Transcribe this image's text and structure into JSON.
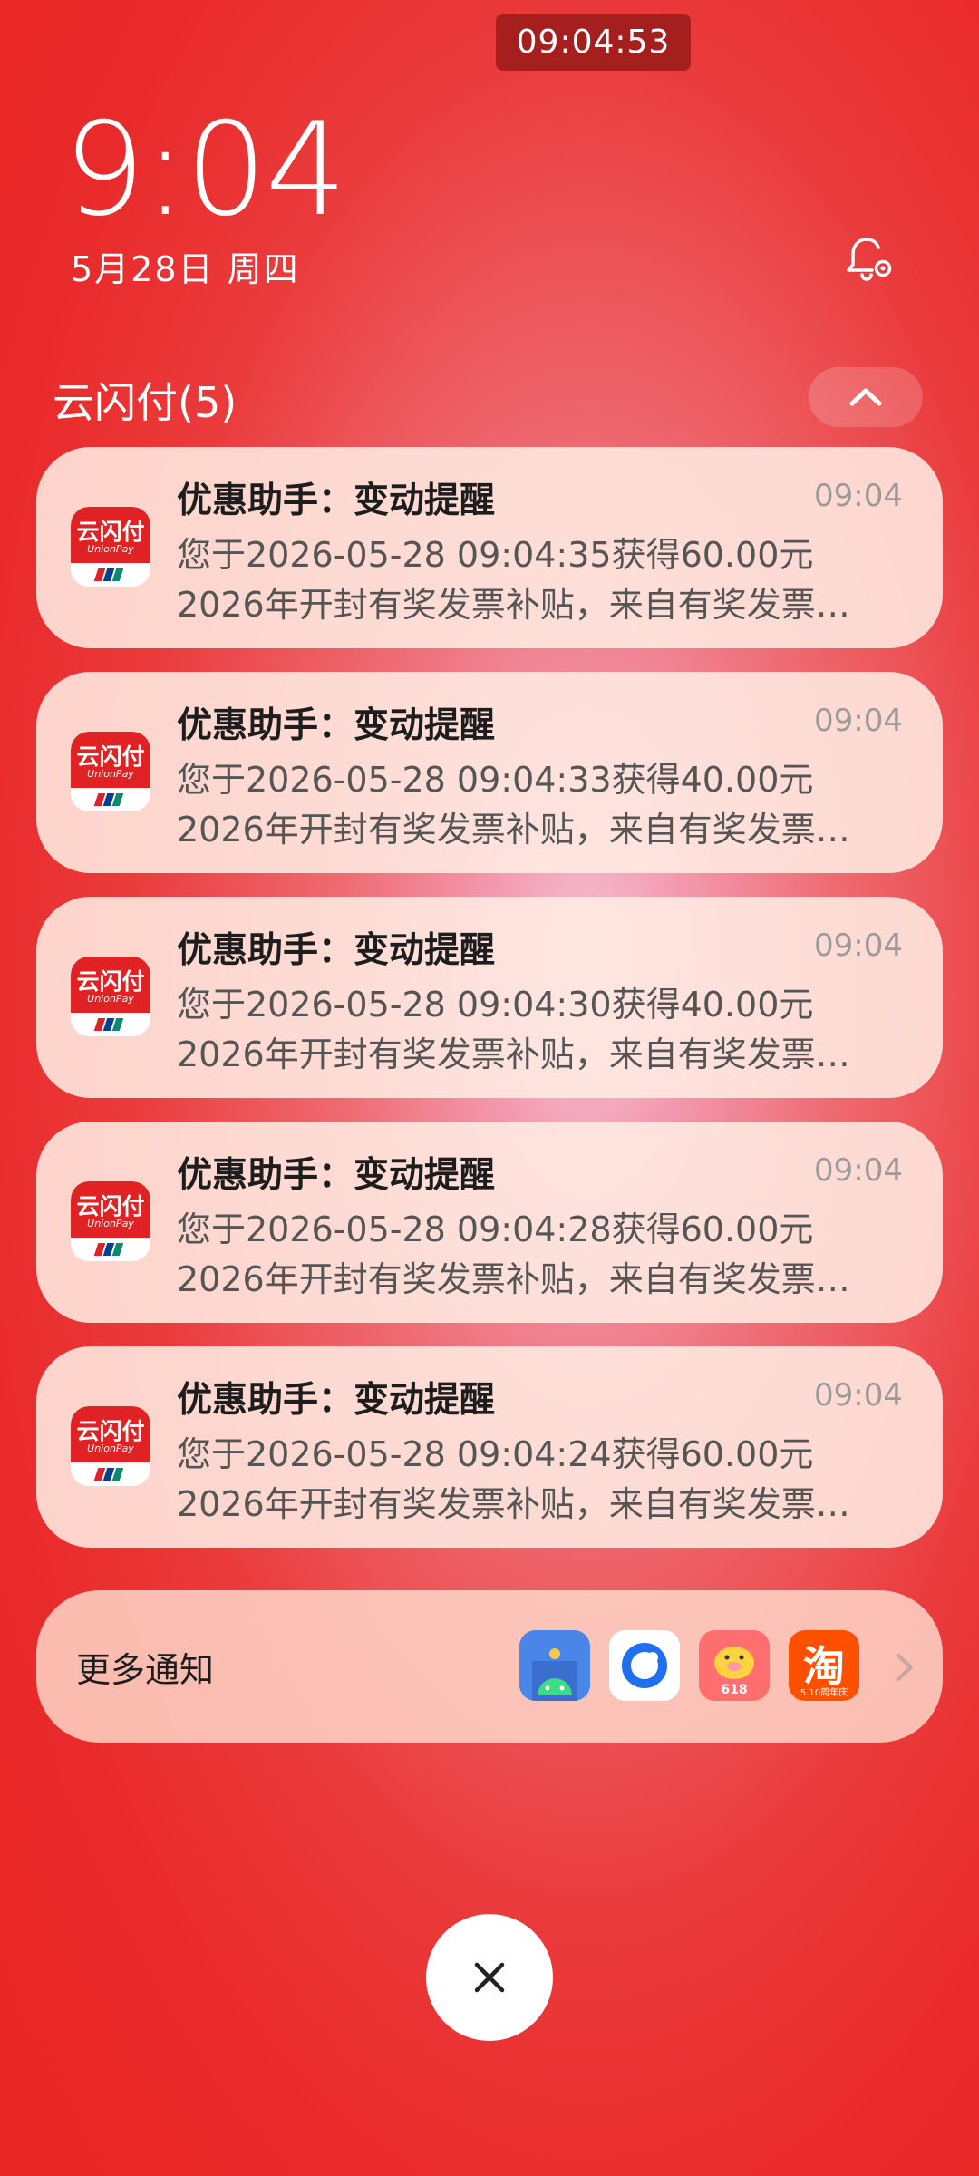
{
  "status": {
    "clock": "09:04:53"
  },
  "lockscreen": {
    "time": "9:04",
    "date": "5月28日 周四"
  },
  "group": {
    "title": "云闪付(5)"
  },
  "app_icon": {
    "brand_text": "云闪付",
    "brand_sub": "UnionPay"
  },
  "notifications": [
    {
      "title": "优惠助手：变动提醒",
      "time": "09:04",
      "line1": "您于2026-05-28 09:04:35获得60.00元",
      "line2": "2026年开封有奖发票补贴，来自有奖发票…"
    },
    {
      "title": "优惠助手：变动提醒",
      "time": "09:04",
      "line1": "您于2026-05-28 09:04:33获得40.00元",
      "line2": "2026年开封有奖发票补贴，来自有奖发票…"
    },
    {
      "title": "优惠助手：变动提醒",
      "time": "09:04",
      "line1": "您于2026-05-28 09:04:30获得40.00元",
      "line2": "2026年开封有奖发票补贴，来自有奖发票…"
    },
    {
      "title": "优惠助手：变动提醒",
      "time": "09:04",
      "line1": "您于2026-05-28 09:04:28获得60.00元",
      "line2": "2026年开封有奖发票补贴，来自有奖发票…"
    },
    {
      "title": "优惠助手：变动提醒",
      "time": "09:04",
      "line1": "您于2026-05-28 09:04:24获得60.00元",
      "line2": "2026年开封有奖发票补贴，来自有奖发票…"
    }
  ],
  "more": {
    "label": "更多通知",
    "apps": [
      {
        "icon": "android-app-icon"
      },
      {
        "icon": "blue-ring-app-icon"
      },
      {
        "icon": "pig-618-app-icon",
        "text": "618"
      },
      {
        "icon": "taobao-app-icon",
        "text": "淘",
        "sub": "5.10周年庆"
      }
    ]
  },
  "colors": {
    "background": "#ea2c2c",
    "unionpay_red": "#e02225",
    "card_bg": "#ffece2"
  }
}
